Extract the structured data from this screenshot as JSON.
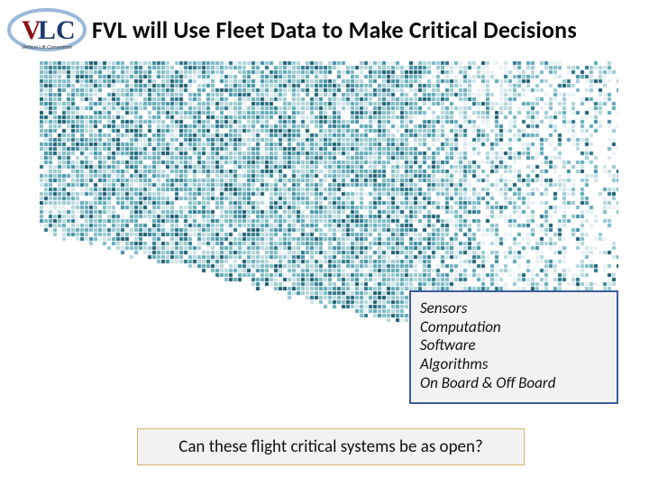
{
  "header": {
    "title": "FVL will Use Fleet Data to Make Critical Decisions",
    "logo_text_red": "V",
    "logo_text_blue": "LC",
    "logo_sub": "Vertical Lift Consortium"
  },
  "viz": {
    "cols": 130,
    "rows": 70,
    "cell": 4,
    "gap": 1,
    "colors": [
      "#ffffff",
      "#e7f1f3",
      "#cfe4e8",
      "#b4d6dc",
      "#98c8d0",
      "#7bb9c4",
      "#5ea8b6",
      "#3e8fa2",
      "#2a7488",
      "#1c5c6f"
    ]
  },
  "callout": {
    "lines": [
      "Sensors",
      "Computation",
      "Software",
      "Algorithms",
      "On Board & Off Board"
    ]
  },
  "question": {
    "text": "Can these flight critical systems be as open?"
  }
}
